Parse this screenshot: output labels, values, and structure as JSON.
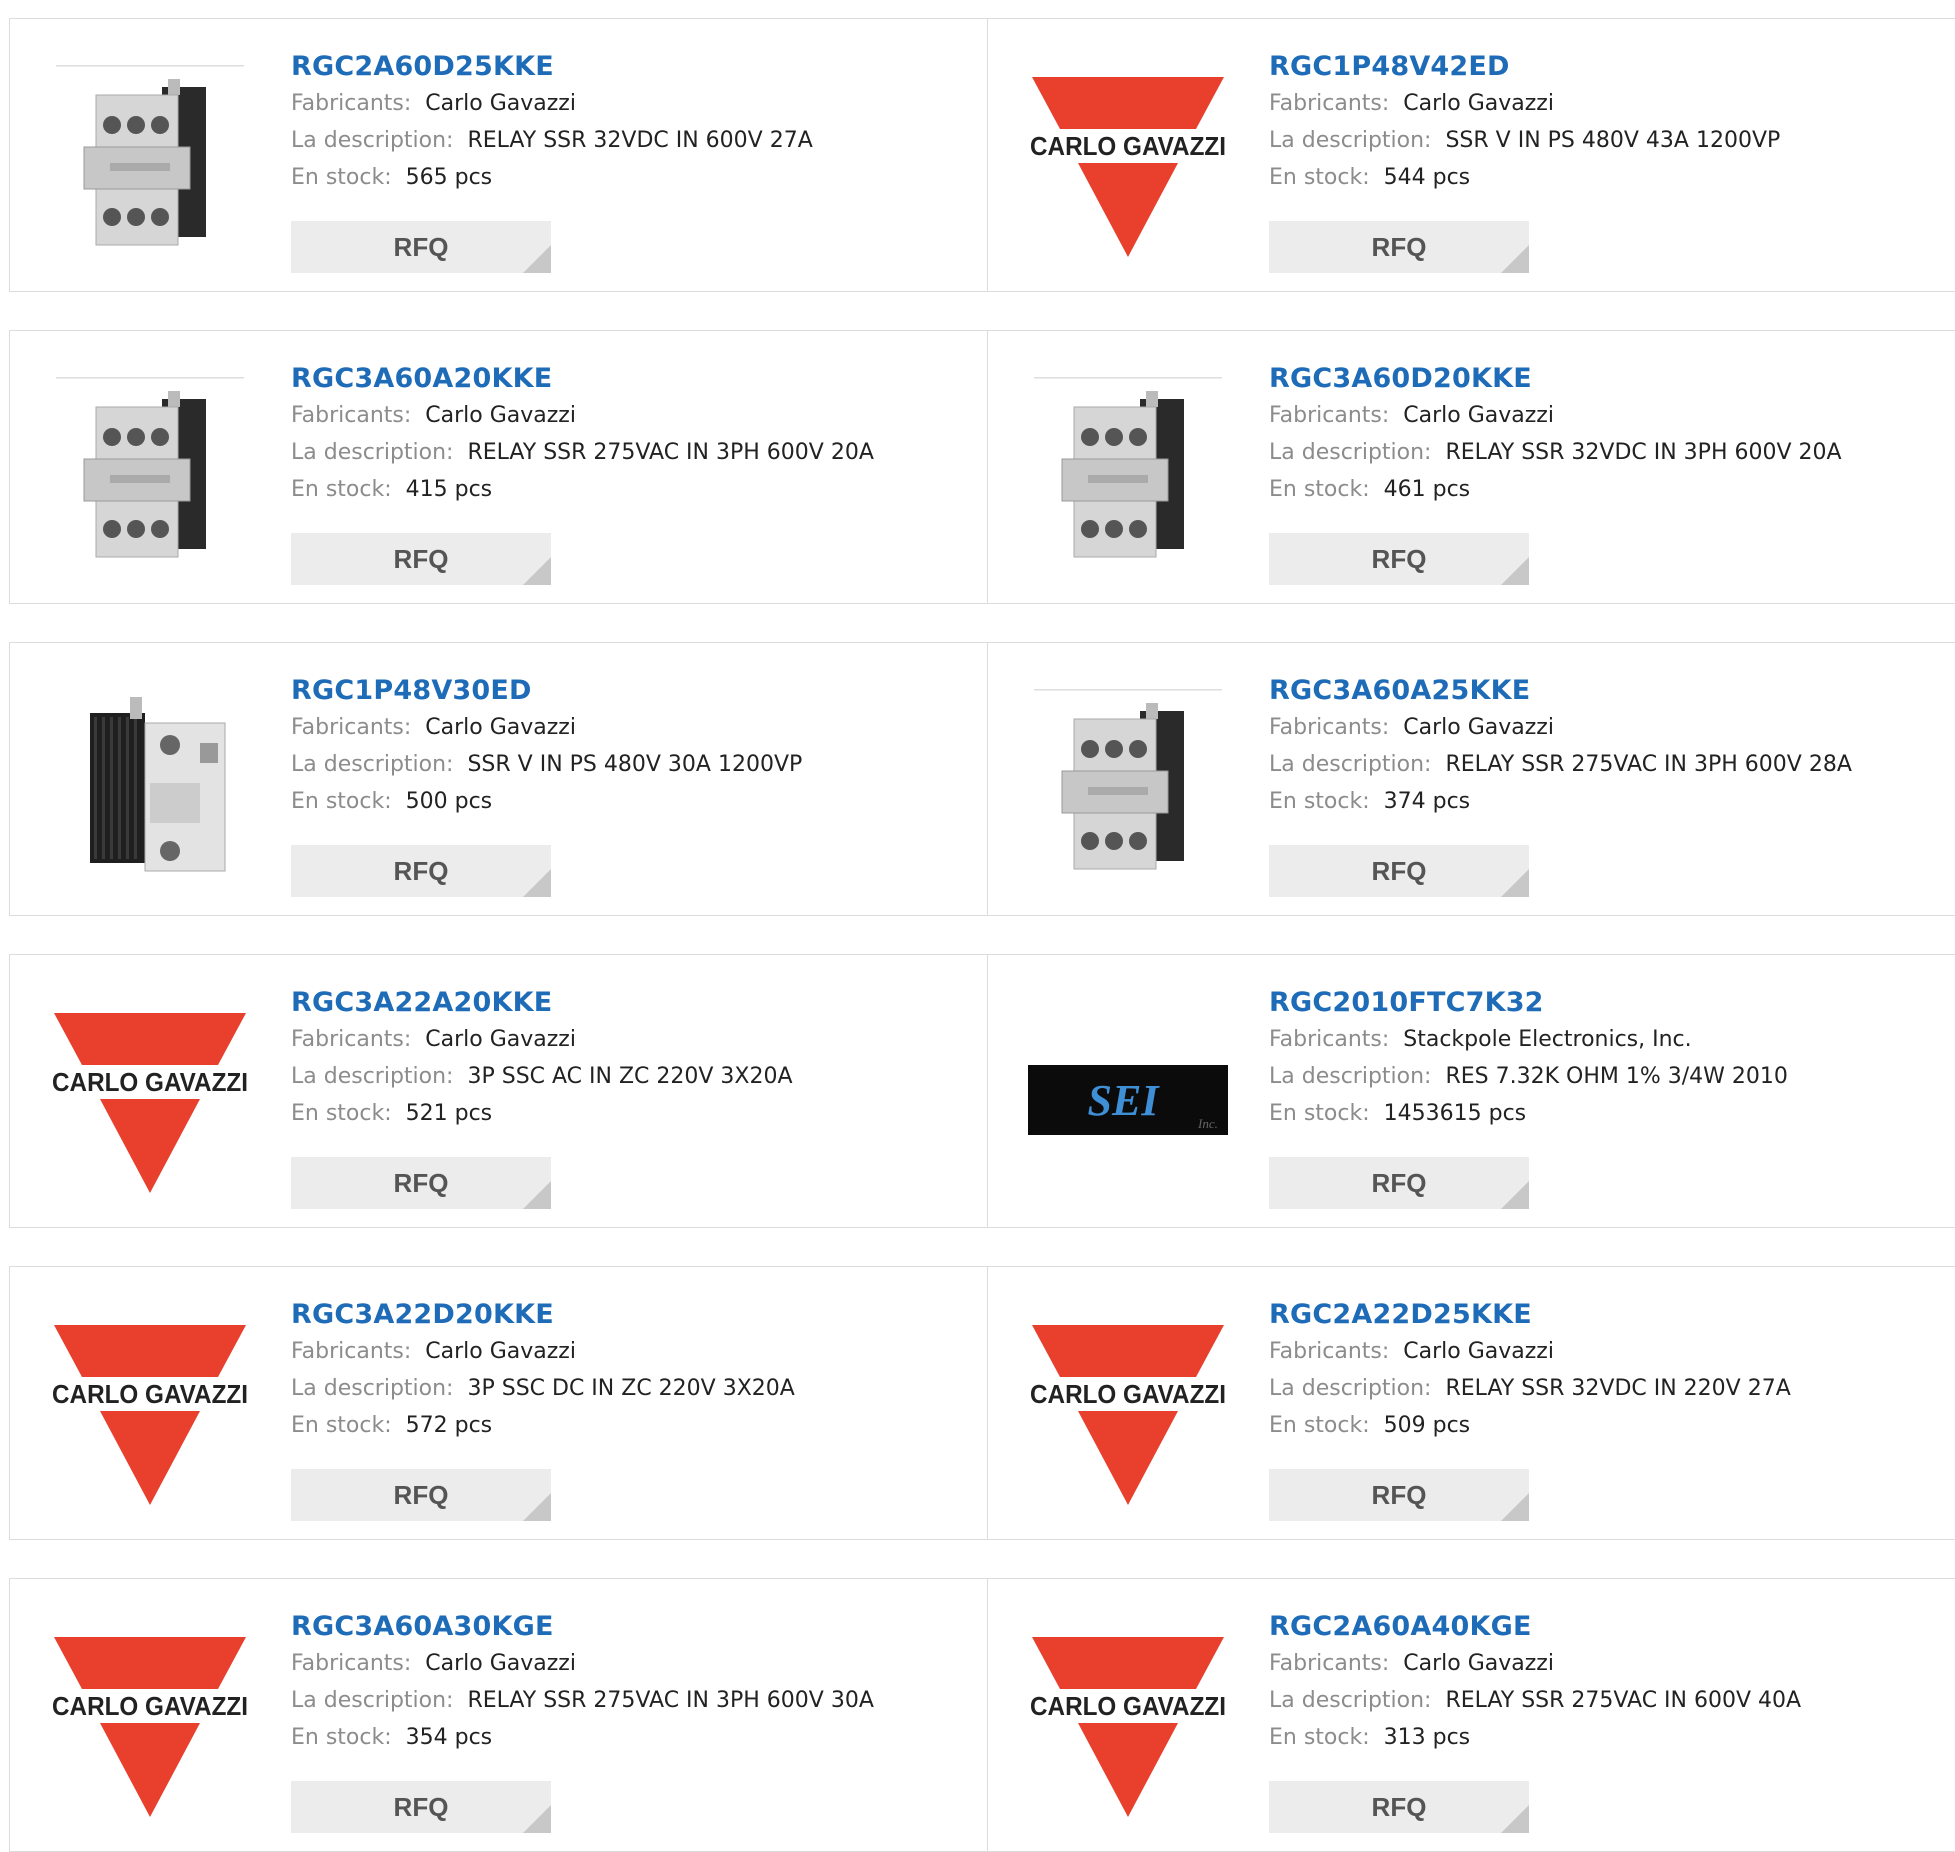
{
  "labels": {
    "manufacturer": "Fabricants:",
    "description": "La description:",
    "stock": "En stock:",
    "rfq": "RFQ"
  },
  "logo_text": {
    "carlo": "CARLO GAVAZZI",
    "sei": "SEI",
    "sei_inc": "Inc."
  },
  "products": [
    {
      "pn": "RGC2A60D25KKE",
      "mfr": "Carlo Gavazzi",
      "desc": "RELAY SSR 32VDC IN 600V 27A",
      "stock": "565 pcs",
      "image": "relay-3pole-icon"
    },
    {
      "pn": "RGC1P48V42ED",
      "mfr": "Carlo Gavazzi",
      "desc": "SSR V IN PS 480V 43A 1200VP",
      "stock": "544 pcs",
      "image": "carlo-gavazzi-logo"
    },
    {
      "pn": "RGC3A60A20KKE",
      "mfr": "Carlo Gavazzi",
      "desc": "RELAY SSR 275VAC IN 3PH 600V 20A",
      "stock": "415 pcs",
      "image": "relay-3pole-icon"
    },
    {
      "pn": "RGC3A60D20KKE",
      "mfr": "Carlo Gavazzi",
      "desc": "RELAY SSR 32VDC IN 3PH 600V 20A",
      "stock": "461 pcs",
      "image": "relay-3pole-icon"
    },
    {
      "pn": "RGC1P48V30ED",
      "mfr": "Carlo Gavazzi",
      "desc": "SSR V IN PS 480V 30A 1200VP",
      "stock": "500 pcs",
      "image": "relay-1pole-icon"
    },
    {
      "pn": "RGC3A60A25KKE",
      "mfr": "Carlo Gavazzi",
      "desc": "RELAY SSR 275VAC IN 3PH 600V 28A",
      "stock": "374 pcs",
      "image": "relay-3pole-icon"
    },
    {
      "pn": "RGC3A22A20KKE",
      "mfr": "Carlo Gavazzi",
      "desc": "3P SSC AC IN ZC 220V 3X20A",
      "stock": "521 pcs",
      "image": "carlo-gavazzi-logo"
    },
    {
      "pn": "RGC2010FTC7K32",
      "mfr": "Stackpole Electronics, Inc.",
      "desc": "RES 7.32K OHM 1% 3/4W 2010",
      "stock": "1453615 pcs",
      "image": "sei-logo"
    },
    {
      "pn": "RGC3A22D20KKE",
      "mfr": "Carlo Gavazzi",
      "desc": "3P SSC DC IN ZC 220V 3X20A",
      "stock": "572 pcs",
      "image": "carlo-gavazzi-logo"
    },
    {
      "pn": "RGC2A22D25KKE",
      "mfr": "Carlo Gavazzi",
      "desc": "RELAY SSR 32VDC IN 220V 27A",
      "stock": "509 pcs",
      "image": "carlo-gavazzi-logo"
    },
    {
      "pn": "RGC3A60A30KGE",
      "mfr": "Carlo Gavazzi",
      "desc": "RELAY SSR 275VAC IN 3PH 600V 30A",
      "stock": "354 pcs",
      "image": "carlo-gavazzi-logo"
    },
    {
      "pn": "RGC2A60A40KGE",
      "mfr": "Carlo Gavazzi",
      "desc": "RELAY SSR 275VAC IN 600V 40A",
      "stock": "313 pcs",
      "image": "carlo-gavazzi-logo"
    }
  ]
}
